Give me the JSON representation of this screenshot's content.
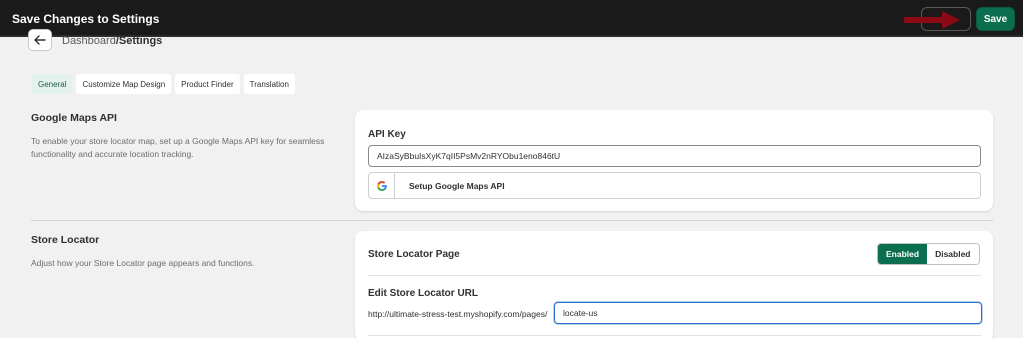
{
  "topbar": {
    "title": "Save Changes to Settings",
    "save_label": "Save"
  },
  "breadcrumb": {
    "parent": "Dashboard",
    "separator": "/",
    "current": "Settings"
  },
  "tabs": [
    {
      "label": "General",
      "active": true
    },
    {
      "label": "Customize Map Design",
      "active": false
    },
    {
      "label": "Product Finder",
      "active": false
    },
    {
      "label": "Translation",
      "active": false
    }
  ],
  "google_maps": {
    "title": "Google Maps API",
    "description": "To enable your store locator map, set up a Google Maps API key for seamless functionality and accurate location tracking.",
    "api_key_label": "API Key",
    "api_key_value": "AIzaSyBbuIsXyK7qII5PsMv2nRYObu1eno846tU",
    "setup_button_label": "Setup Google Maps API"
  },
  "store_locator": {
    "title": "Store Locator",
    "description": "Adjust how your Store Locator page appears and functions.",
    "page_label": "Store Locator Page",
    "enabled_label": "Enabled",
    "disabled_label": "Disabled",
    "selected": "Enabled",
    "url_label": "Edit Store Locator URL",
    "url_prefix": "http://ultimate-stress-test.myshopify.com/pages/",
    "url_value": "locate-us"
  },
  "colors": {
    "accent": "#0b6e4f",
    "topbar": "#1a1a1a",
    "annotation_arrow": "#8b0a14"
  },
  "icons": [
    "back-arrow-icon",
    "google-icon",
    "annotation-arrow"
  ]
}
